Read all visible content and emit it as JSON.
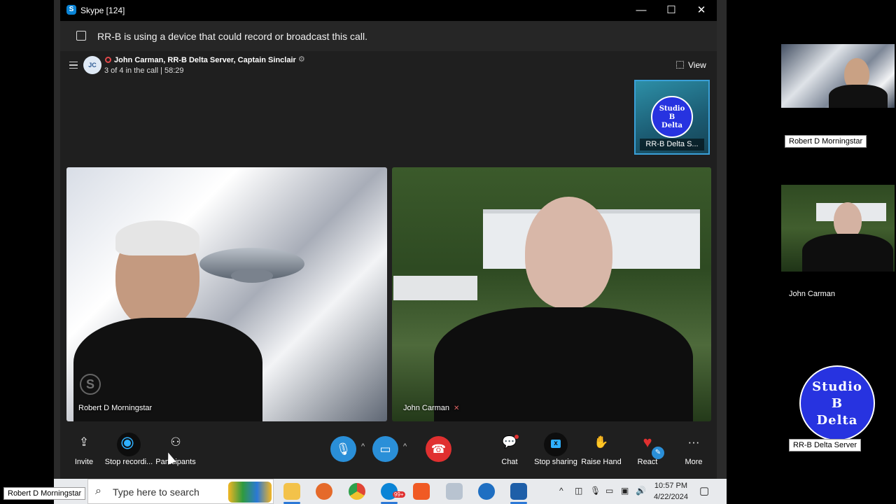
{
  "window": {
    "title": "Skype [124]",
    "controls": {
      "minimize": "—",
      "maximize": "☐",
      "close": "✕"
    }
  },
  "notice": {
    "text": "RR-B is using a device that could record or broadcast this call."
  },
  "call": {
    "avatar_initials": "JC",
    "title": "John Carman, RR-B Delta Server, Captain Sinclair",
    "subtitle": "3 of 4 in the call | 58:29",
    "view_label": "View"
  },
  "self_tile": {
    "logo_lines": [
      "Studio",
      "B",
      "Delta"
    ],
    "label": "RR-B Delta S..."
  },
  "videos": {
    "left": {
      "name": "Robert D Morningstar"
    },
    "right": {
      "name": "John Carman"
    }
  },
  "controls": {
    "invite": "Invite",
    "stop_recording": "Stop recordi...",
    "participants": "Participants",
    "chat": "Chat",
    "stop_sharing": "Stop sharing",
    "raise_hand": "Raise Hand",
    "react": "React",
    "more": "More"
  },
  "side_panel": {
    "robert_label": "Robert D Morningstar",
    "john_label": "John Carman",
    "logo_lines": [
      "Studio",
      "B",
      "Delta"
    ],
    "logo_label": "RR-B Delta Server"
  },
  "taskbar": {
    "search_placeholder": "Type here to search",
    "time": "10:57 PM",
    "date": "4/22/2024",
    "skype_badge": "99+"
  },
  "bottom_name": "Robert D Morningstar",
  "colors": {
    "accent": "#2fb0ff",
    "mic_button": "#2a8fd8",
    "end_call": "#e03030",
    "logo_blue": "#2733e0"
  }
}
